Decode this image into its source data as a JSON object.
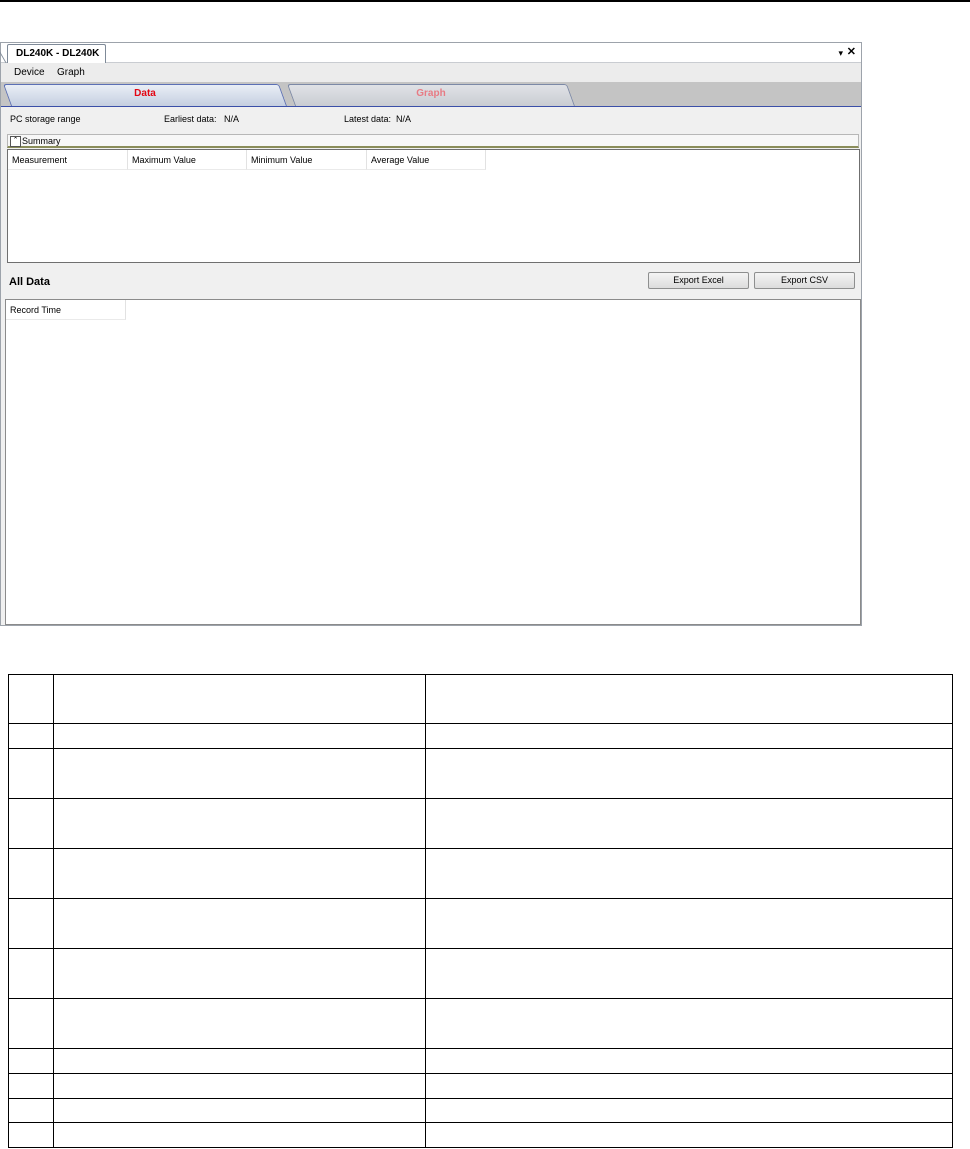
{
  "window": {
    "doc_tab_title": "DL240K - DL240K",
    "pin_glyph": "▾",
    "close_glyph": "✕"
  },
  "menu": {
    "items": [
      "Device",
      "Graph"
    ]
  },
  "tabs": [
    {
      "label": "Data",
      "active": true,
      "color": "#e30613"
    },
    {
      "label": "Graph",
      "active": false,
      "color": "#e77b84"
    }
  ],
  "storage": {
    "label": "PC storage range",
    "earliest_label": "Earliest data:",
    "earliest_value": "N/A",
    "latest_label": "Latest data:",
    "latest_value": "N/A"
  },
  "summary": {
    "collapse_glyph": "⌃",
    "title": "Summary",
    "columns": [
      "Measurement",
      "Maximum Value",
      "Minimum Value",
      "Average Value"
    ]
  },
  "all_data": {
    "title": "All Data",
    "export_excel": "Export Excel",
    "export_csv": "Export CSV",
    "columns": [
      "Record Time"
    ]
  }
}
